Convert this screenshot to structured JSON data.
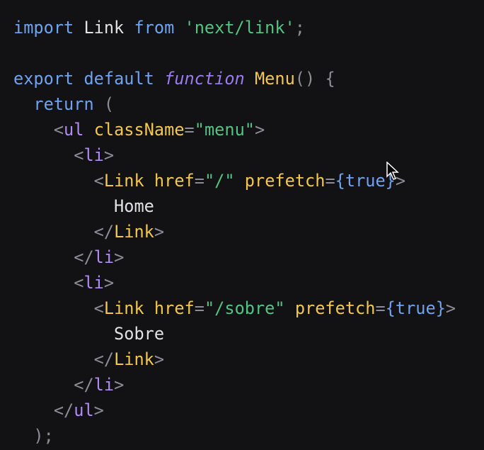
{
  "editor": {
    "lines": [
      {
        "tokens": [
          [
            "kw",
            "import"
          ],
          [
            "plain",
            " Link "
          ],
          [
            "kw",
            "from"
          ],
          [
            "plain",
            " "
          ],
          [
            "str",
            "'next/link'"
          ],
          [
            "punc",
            ";"
          ]
        ]
      },
      {
        "tokens": []
      },
      {
        "tokens": [
          [
            "kw",
            "export"
          ],
          [
            "plain",
            " "
          ],
          [
            "kw",
            "default"
          ],
          [
            "plain",
            " "
          ],
          [
            "kw-italic",
            "function"
          ],
          [
            "plain",
            " "
          ],
          [
            "fn",
            "Menu"
          ],
          [
            "punc",
            "()"
          ],
          [
            "plain",
            " "
          ],
          [
            "punc",
            "{"
          ]
        ]
      },
      {
        "tokens": [
          [
            "plain",
            "  "
          ],
          [
            "kw",
            "return"
          ],
          [
            "plain",
            " "
          ],
          [
            "punc",
            "("
          ]
        ]
      },
      {
        "tokens": [
          [
            "plain",
            "    "
          ],
          [
            "punc",
            "<"
          ],
          [
            "ul-tag",
            "ul"
          ],
          [
            "plain",
            " "
          ],
          [
            "attr",
            "className"
          ],
          [
            "punc",
            "="
          ],
          [
            "str",
            "\"menu\""
          ],
          [
            "punc",
            ">"
          ]
        ]
      },
      {
        "tokens": [
          [
            "plain",
            "      "
          ],
          [
            "punc",
            "<"
          ],
          [
            "ul-tag",
            "li"
          ],
          [
            "punc",
            ">"
          ]
        ]
      },
      {
        "tokens": [
          [
            "plain",
            "        "
          ],
          [
            "punc",
            "<"
          ],
          [
            "tag",
            "Link"
          ],
          [
            "plain",
            " "
          ],
          [
            "attr",
            "href"
          ],
          [
            "punc",
            "="
          ],
          [
            "str",
            "\"/\""
          ],
          [
            "plain",
            " "
          ],
          [
            "attr",
            "prefetch"
          ],
          [
            "punc",
            "="
          ],
          [
            "bool",
            "{true}"
          ],
          [
            "punc",
            ">"
          ]
        ]
      },
      {
        "tokens": [
          [
            "plain",
            "          Home"
          ]
        ]
      },
      {
        "tokens": [
          [
            "plain",
            "        "
          ],
          [
            "punc",
            "</"
          ],
          [
            "tag",
            "Link"
          ],
          [
            "punc",
            ">"
          ]
        ]
      },
      {
        "tokens": [
          [
            "plain",
            "      "
          ],
          [
            "punc",
            "</"
          ],
          [
            "ul-tag",
            "li"
          ],
          [
            "punc",
            ">"
          ]
        ]
      },
      {
        "tokens": [
          [
            "plain",
            "      "
          ],
          [
            "punc",
            "<"
          ],
          [
            "ul-tag",
            "li"
          ],
          [
            "punc",
            ">"
          ]
        ]
      },
      {
        "tokens": [
          [
            "plain",
            "        "
          ],
          [
            "punc",
            "<"
          ],
          [
            "tag",
            "Link"
          ],
          [
            "plain",
            " "
          ],
          [
            "attr",
            "href"
          ],
          [
            "punc",
            "="
          ],
          [
            "str",
            "\"/sobre\""
          ],
          [
            "plain",
            " "
          ],
          [
            "attr",
            "prefetch"
          ],
          [
            "punc",
            "="
          ],
          [
            "bool",
            "{true}"
          ],
          [
            "punc",
            ">"
          ]
        ]
      },
      {
        "tokens": [
          [
            "plain",
            "          Sobre"
          ]
        ]
      },
      {
        "tokens": [
          [
            "plain",
            "        "
          ],
          [
            "punc",
            "</"
          ],
          [
            "tag",
            "Link"
          ],
          [
            "punc",
            ">"
          ]
        ]
      },
      {
        "tokens": [
          [
            "plain",
            "      "
          ],
          [
            "punc",
            "</"
          ],
          [
            "ul-tag",
            "li"
          ],
          [
            "punc",
            ">"
          ]
        ]
      },
      {
        "tokens": [
          [
            "plain",
            "    "
          ],
          [
            "punc",
            "</"
          ],
          [
            "ul-tag",
            "ul"
          ],
          [
            "punc",
            ">"
          ]
        ]
      },
      {
        "tokens": [
          [
            "plain",
            "  "
          ],
          [
            "punc",
            ");"
          ]
        ]
      }
    ]
  },
  "colors": {
    "background": "#121214",
    "keyword": "#6fa3f0",
    "string": "#52c483",
    "component": "#f4c84e",
    "html_tag": "#b08bf5",
    "punctuation": "#8d8d99",
    "text": "#e1e1e6"
  },
  "cursor": {
    "icon": "mouse-pointer-icon"
  }
}
